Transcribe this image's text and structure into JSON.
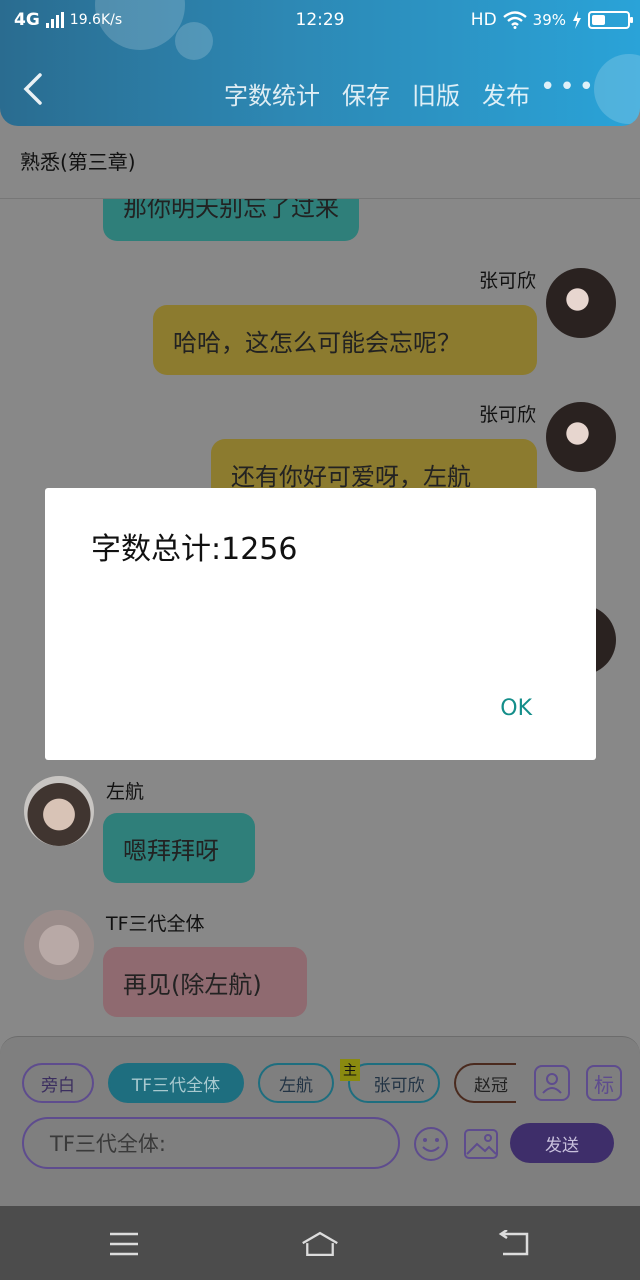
{
  "status_bar": {
    "network": "4G",
    "speed": "19.6K/s",
    "time": "12:29",
    "hd": "HD",
    "battery": "39%",
    "battery_level": 0.39
  },
  "toolbar": {
    "back_icon": "chevron-left-icon",
    "items": [
      "字数统计",
      "保存",
      "旧版",
      "发布"
    ],
    "more_icon": "more-dots-icon"
  },
  "chapter_title": "熟悉(第三章)",
  "chat": [
    {
      "side": "left",
      "text": "那你明天别忘了过来",
      "color": "teal"
    },
    {
      "side": "right",
      "sender": "张可欣",
      "text": "哈哈，这怎么可能会忘呢？",
      "color": "yellow"
    },
    {
      "side": "right",
      "sender": "张可欣",
      "text": "还有你好可爱呀，左航",
      "color": "yellow"
    },
    {
      "side": "left",
      "sender": "左航",
      "text": "嗯拜拜呀",
      "color": "teal"
    },
    {
      "side": "left",
      "sender": "TF三代全体",
      "text": "再见(除左航)",
      "color": "pink"
    }
  ],
  "roles": [
    {
      "label": "旁白"
    },
    {
      "label": "TF三代全体",
      "selected": true
    },
    {
      "label": "左航"
    },
    {
      "label": "张可欣",
      "badge": "主"
    },
    {
      "label": "赵冠"
    }
  ],
  "input": {
    "value": "TF三代全体:",
    "send_label": "发送",
    "role_icon": "person-icon",
    "tag_label": "标"
  },
  "dialog": {
    "message": "字数总计:1256",
    "ok_label": "OK"
  },
  "nav": [
    "menu-icon",
    "home-icon",
    "back-icon"
  ],
  "colors": {
    "header": "#2d88b4",
    "teal_bubble": "#2f7f7a",
    "yellow_bubble": "#8c7b2f",
    "pink_bubble": "#8f6a70",
    "accent_purple": "#5e4c8e",
    "ok_text": "#148e8a"
  }
}
